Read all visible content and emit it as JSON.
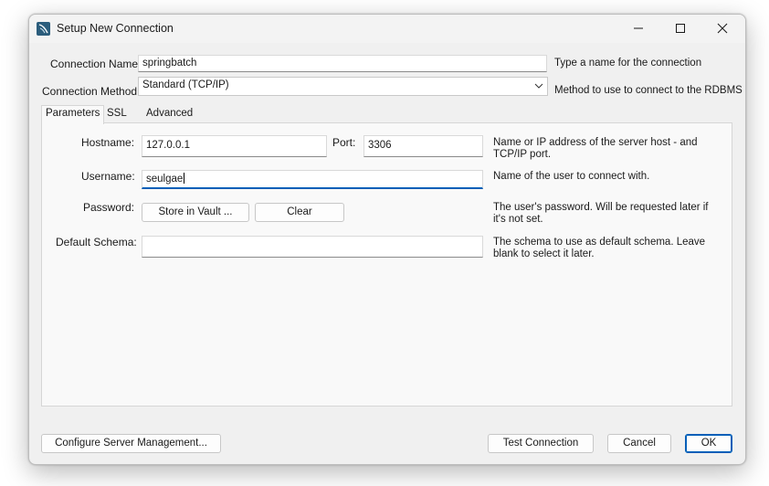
{
  "window": {
    "title": "Setup New Connection",
    "controls": {
      "minimize": "minimize-icon",
      "maximize": "maximize-icon",
      "close": "close-icon"
    }
  },
  "connection_name": {
    "label": "Connection Name:",
    "value": "springbatch",
    "hint": "Type a name for the connection"
  },
  "connection_method": {
    "label": "Connection Method:",
    "value": "Standard (TCP/IP)",
    "hint": "Method to use to connect to the RDBMS"
  },
  "tabs": [
    {
      "label": "Parameters",
      "active": true
    },
    {
      "label": "SSL",
      "active": false
    },
    {
      "label": "Advanced",
      "active": false
    }
  ],
  "parameters": {
    "hostname": {
      "label": "Hostname:",
      "value": "127.0.0.1",
      "hint": "Name or IP address of the server host - and TCP/IP port."
    },
    "port": {
      "label": "Port:",
      "value": "3306"
    },
    "username": {
      "label": "Username:",
      "value": "seulgae",
      "hint": "Name of the user to connect with."
    },
    "password": {
      "label": "Password:",
      "store_button": "Store in Vault ...",
      "clear_button": "Clear",
      "hint": "The user's password. Will be requested later if it's not set."
    },
    "default_schema": {
      "label": "Default Schema:",
      "value": "",
      "hint": "The schema to use as default schema. Leave blank to select it later."
    }
  },
  "footer": {
    "configure_button": "Configure Server Management...",
    "test_button": "Test Connection",
    "cancel_button": "Cancel",
    "ok_button": "OK"
  },
  "colors": {
    "accent": "#005fb8",
    "window_bg": "#f0f0f0",
    "panel_bg": "#f9f9f9"
  }
}
